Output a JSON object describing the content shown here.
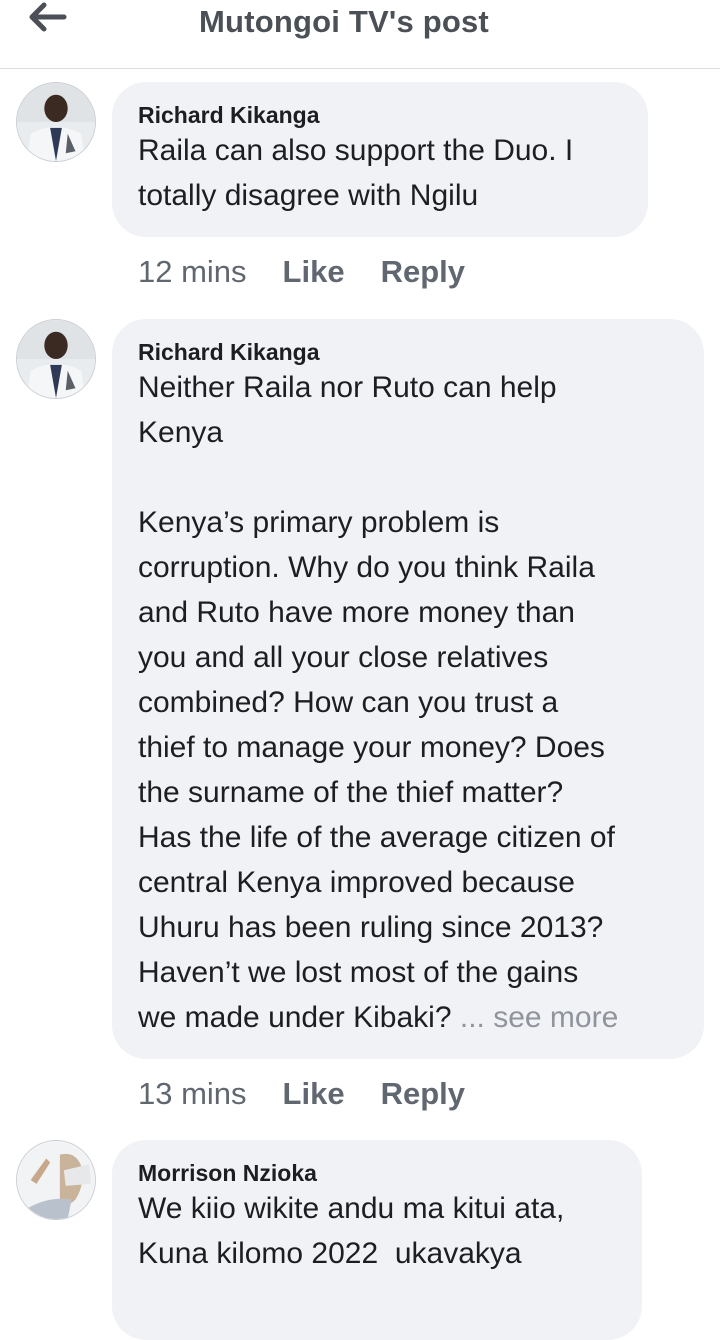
{
  "header": {
    "title": "Mutongoi TV's post",
    "back_icon": "back-arrow-icon"
  },
  "comments": [
    {
      "author": "Richard Kikanga",
      "text": "Raila can also support the Duo. I\ntotally disagree with Ngilu",
      "time": "12 mins",
      "like": "Like",
      "reply": "Reply"
    },
    {
      "author": "Richard Kikanga",
      "text": "Neither Raila nor Ruto can help\nKenya\n\nKenya’s primary problem is\ncorruption. Why do you think Raila\nand Ruto have more money than\nyou and all your close relatives\ncombined? How can you trust a\nthief to manage your money? Does\nthe surname of the thief matter?\nHas the life of the average citizen of\ncentral Kenya improved because\nUhuru has been ruling since 2013?\nHaven’t we lost most of the gains\nwe made under Kibaki? ",
      "see_more": "... see more",
      "time": "13 mins",
      "like": "Like",
      "reply": "Reply"
    },
    {
      "author": "Morrison Nzioka",
      "text": "We kiio wikite andu ma kitui ata,\nKuna kilomo 2022  ukavakya"
    }
  ]
}
